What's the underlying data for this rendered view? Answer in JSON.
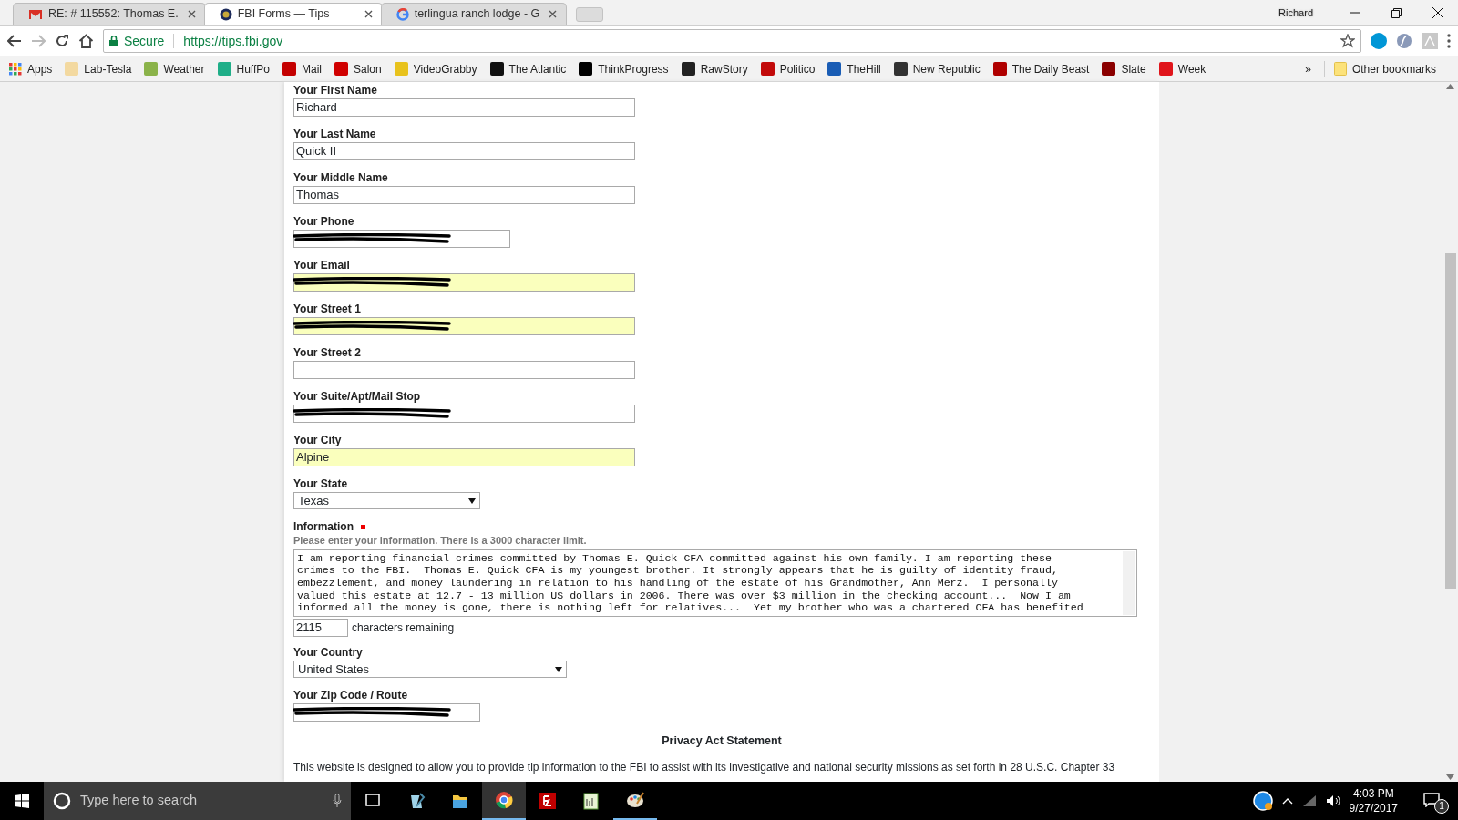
{
  "browser": {
    "tabs": [
      {
        "title": "RE: # 115552: Thomas E.",
        "selected": false
      },
      {
        "title": "FBI Forms — Tips",
        "selected": true
      },
      {
        "title": "terlingua ranch lodge - G",
        "selected": false
      }
    ],
    "profile": "Richard",
    "secure_label": "Secure",
    "url": "https://tips.fbi.gov",
    "bookmarks": [
      {
        "label": "Apps"
      },
      {
        "label": "Lab-Tesla",
        "color": "#f3d9a0"
      },
      {
        "label": "Weather",
        "color": "#8bb34a"
      },
      {
        "label": "HuffPo",
        "color": "#1fae88"
      },
      {
        "label": "Mail",
        "color": "#c40000"
      },
      {
        "label": "Salon",
        "color": "#d00000"
      },
      {
        "label": "VideoGrabby",
        "color": "#e8c21c"
      },
      {
        "label": "The Atlantic",
        "color": "#111111"
      },
      {
        "label": "ThinkProgress",
        "color": "#000000"
      },
      {
        "label": "RawStory",
        "color": "#222222"
      },
      {
        "label": "Politico",
        "color": "#c20a0a"
      },
      {
        "label": "TheHill",
        "color": "#1a5db5"
      },
      {
        "label": "New Republic",
        "color": "#333333"
      },
      {
        "label": "The Daily Beast",
        "color": "#b00000"
      },
      {
        "label": "Slate",
        "color": "#8b0000"
      },
      {
        "label": "Week",
        "color": "#e0151b"
      }
    ],
    "overflow": "»",
    "other_bookmarks": "Other bookmarks"
  },
  "form": {
    "fields": [
      {
        "label": "Your First Name",
        "kind": "text",
        "value": "Richard",
        "autofilled": false,
        "redacted": false
      },
      {
        "label": "Your Last Name",
        "kind": "text",
        "value": "Quick II",
        "autofilled": false,
        "redacted": false
      },
      {
        "label": "Your Middle Name",
        "kind": "text",
        "value": "Thomas",
        "autofilled": false,
        "redacted": false
      },
      {
        "label": "Your Phone",
        "kind": "text",
        "autofilled": false,
        "redacted": true
      },
      {
        "label": "Your Email",
        "kind": "text",
        "autofilled": true,
        "redacted": true
      },
      {
        "label": "Your Street 1",
        "kind": "text",
        "autofilled": true,
        "redacted": true
      },
      {
        "label": "Your Street 2",
        "kind": "text",
        "autofilled": false,
        "redacted": false
      },
      {
        "label": "Your Suite/Apt/Mail Stop",
        "kind": "text",
        "autofilled": false,
        "redacted": true
      },
      {
        "label": "Your City",
        "kind": "text",
        "value": "Alpine",
        "autofilled": true,
        "redacted": false
      },
      {
        "label": "Your State",
        "kind": "select",
        "value": "Texas"
      }
    ],
    "information": {
      "label": "Information",
      "required": true,
      "hint": "Please enter your information. There is a 3000 character limit.",
      "text": "I am reporting financial crimes committed by Thomas E. Quick CFA committed against his own family. I am reporting these crimes to the FBI.  Thomas E. Quick CFA is my youngest brother. It strongly appears that he is guilty of identity fraud, embezzlement, and money laundering in relation to his handling of the estate of his Grandmother, Ann Merz.  I personally valued this estate at 12.7 - 13 million US dollars in 2006. There was over $3 million in the checking account...  Now I am informed all the money is gone, there is nothing left for relatives...  Yet my brother who was a chartered CFA has benefited",
      "count": "2115",
      "count_label": "characters remaining"
    },
    "fields_after": [
      {
        "label": "Your Country",
        "kind": "select",
        "value": "United States"
      },
      {
        "label": "Your Zip Code / Route",
        "kind": "text",
        "autofilled": false,
        "redacted": true
      }
    ],
    "privacy_title": "Privacy Act Statement",
    "privacy_text": "This website is designed to allow you to provide tip information to the FBI to assist with its investigative and national security missions as set forth in 28 U.S.C. Chapter 33"
  },
  "taskbar": {
    "search_placeholder": "Type here to search",
    "time": "4:03 PM",
    "date": "9/27/2017",
    "notifications": "1"
  }
}
